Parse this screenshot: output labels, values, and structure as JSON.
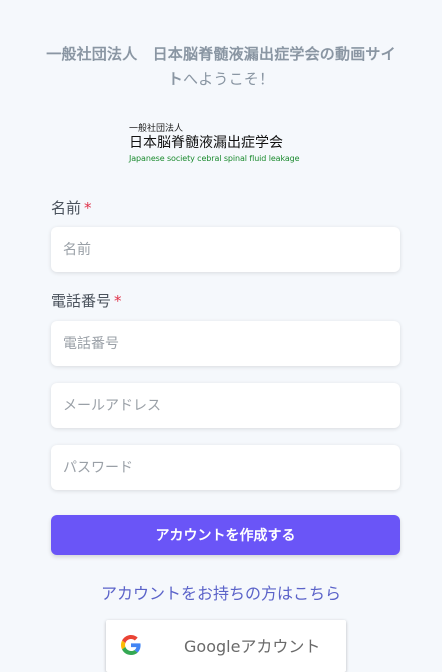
{
  "welcome": {
    "bold_text": "一般社団法人　日本脳脊髄液漏出症学会の動画サイト",
    "light_text": "へようこそ！"
  },
  "logo": {
    "line1": "一般社団法人",
    "line2": "日本脳脊髄液漏出症学会",
    "line3": "Japanese society cebral spinal fluid leakage"
  },
  "form": {
    "name_label": "名前",
    "name_required": "*",
    "name_placeholder": "名前",
    "phone_label": "電話番号",
    "phone_required": "*",
    "phone_placeholder": "電話番号",
    "email_placeholder": "メールアドレス",
    "password_placeholder": "パスワード",
    "submit_label": "アカウントを作成する"
  },
  "login_link": "アカウントをお持ちの方はこちら",
  "google_button": {
    "label": "Googleアカウント",
    "icon": "google-g-icon"
  },
  "colors": {
    "accent": "#6a55f7",
    "link": "#5b63c9",
    "required": "#e0344b",
    "background": "#f5f8fc"
  }
}
